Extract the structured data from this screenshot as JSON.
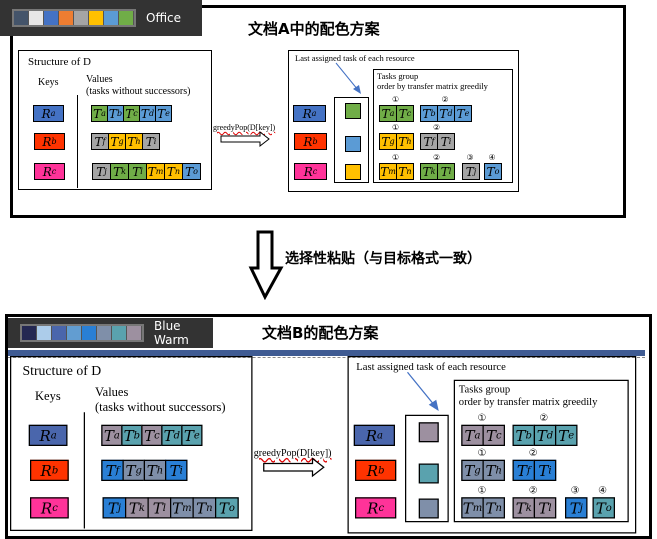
{
  "top": {
    "palette_name": "Office",
    "swatches": [
      "#44546a",
      "#e7e6e6",
      "#4472c4",
      "#ed7d31",
      "#a5a5a5",
      "#ffc000",
      "#5b9bd5",
      "#70ad47"
    ],
    "title": "文档A中的配色方案",
    "key_colors": [
      "#4472c4",
      "#ff3300",
      "#ff3399"
    ],
    "task_colors": {
      "Ta": "#70ad47",
      "Tb": "#5b9bd5",
      "Tc": "#70ad47",
      "Td": "#5b9bd5",
      "Te": "#5b9bd5",
      "Tf": "#a5a5a5",
      "Tg": "#ffc000",
      "Th": "#ffc000",
      "Ti": "#a5a5a5",
      "Tj": "#a5a5a5",
      "Tk": "#70ad47",
      "Tl": "#70ad47",
      "Tm": "#ffc000",
      "Tn": "#ffc000",
      "To": "#5b9bd5"
    },
    "last_colors": [
      "#70ad47",
      "#5b9bd5",
      "#ffc000"
    ]
  },
  "bottom": {
    "palette_name": "Blue Warm",
    "swatches": [
      "#242852",
      "#acccea",
      "#4a66ac",
      "#629dd1",
      "#297fd5",
      "#7f8fa9",
      "#5aa2ae",
      "#9d90a0"
    ],
    "title": "文档B的配色方案",
    "key_colors": [
      "#4a66ac",
      "#ff3300",
      "#ff3399"
    ],
    "task_colors": {
      "Ta": "#9d90a0",
      "Tb": "#5aa2ae",
      "Tc": "#9d90a0",
      "Td": "#5aa2ae",
      "Te": "#5aa2ae",
      "Tf": "#297fd5",
      "Tg": "#7f8fa9",
      "Th": "#7f8fa9",
      "Ti": "#297fd5",
      "Tj": "#297fd5",
      "Tk": "#9d90a0",
      "Tl": "#9d90a0",
      "Tm": "#7f8fa9",
      "Tn": "#7f8fa9",
      "To": "#5aa2ae"
    },
    "last_colors": [
      "#9d90a0",
      "#5aa2ae",
      "#7f8fa9"
    ]
  },
  "diagram": {
    "structure_title": "Structure of D",
    "keys_label": "Keys",
    "values_label": "Values",
    "values_sub": "(tasks without successors)",
    "keys": [
      "Ra",
      "Rb",
      "Rc"
    ],
    "values": [
      [
        "Ta",
        "Tb",
        "Tc",
        "Td",
        "Te"
      ],
      [
        "Tf",
        "Tg",
        "Th",
        "Ti"
      ],
      [
        "Tj",
        "Tk",
        "Tl",
        "Tm",
        "Tn",
        "To"
      ]
    ],
    "op_label": "greedyPop(D[key])",
    "last_label": "Last assigned task of each resource",
    "group_title": "Tasks group",
    "group_sub": "order by transfer matrix greedily",
    "groups": [
      [
        {
          "n": "①",
          "tasks": [
            "Ta",
            "Tc"
          ]
        },
        {
          "n": "②",
          "tasks": [
            "Tb",
            "Td",
            "Te"
          ]
        }
      ],
      [
        {
          "n": "①",
          "tasks": [
            "Tg",
            "Th"
          ]
        },
        {
          "n": "②",
          "tasks": [
            "Tf",
            "Ti"
          ]
        }
      ],
      [
        {
          "n": "①",
          "tasks": [
            "Tm",
            "Tn"
          ]
        },
        {
          "n": "②",
          "tasks": [
            "Tk",
            "Tl"
          ]
        },
        {
          "n": "③",
          "tasks": [
            "Tj"
          ]
        },
        {
          "n": "④",
          "tasks": [
            "To"
          ]
        }
      ]
    ]
  },
  "paste_label": "选择性粘贴（与目标格式一致）",
  "border_accent": "#3f5b93"
}
